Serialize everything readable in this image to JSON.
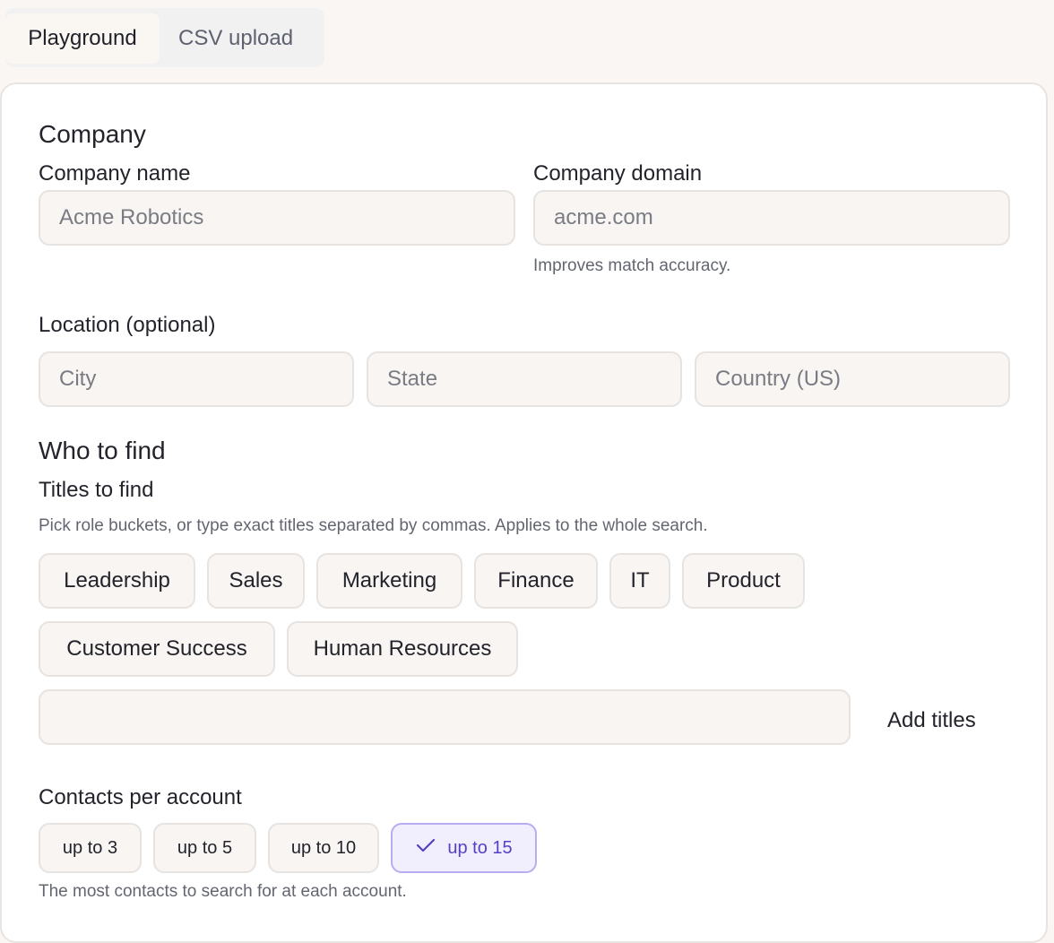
{
  "tabs": [
    {
      "label": "Playground",
      "active": true
    },
    {
      "label": "CSV upload",
      "active": false
    }
  ],
  "company": {
    "section_title": "Company",
    "name_label": "Company name",
    "name_placeholder": "Acme Robotics",
    "domain_label": "Company domain",
    "domain_placeholder": "acme.com",
    "domain_hint": "Improves match accuracy."
  },
  "location": {
    "label": "Location (optional)",
    "city_placeholder": "City",
    "state_placeholder": "State",
    "country_placeholder": "Country (US)"
  },
  "who": {
    "section_title": "Who to find",
    "titles_label": "Titles to find",
    "titles_hint": "Pick role buckets, or type exact titles separated by commas. Applies to the whole search.",
    "role_buckets": [
      "Leadership",
      "Sales",
      "Marketing",
      "Finance",
      "IT",
      "Product",
      "Customer Success",
      "Human Resources"
    ],
    "titles_input_value": "",
    "add_titles_label": "Add titles"
  },
  "contacts": {
    "label": "Contacts per account",
    "options": [
      "up to 3",
      "up to 5",
      "up to 10",
      "up to 15"
    ],
    "selected": "up to 15",
    "hint": "The most contacts to search for at each account."
  },
  "colors": {
    "page_bg": "#f9f6f3",
    "accent": "#5541c3",
    "accent_bg": "#f1eefe"
  },
  "icons": {
    "selected_check": "check-icon"
  }
}
